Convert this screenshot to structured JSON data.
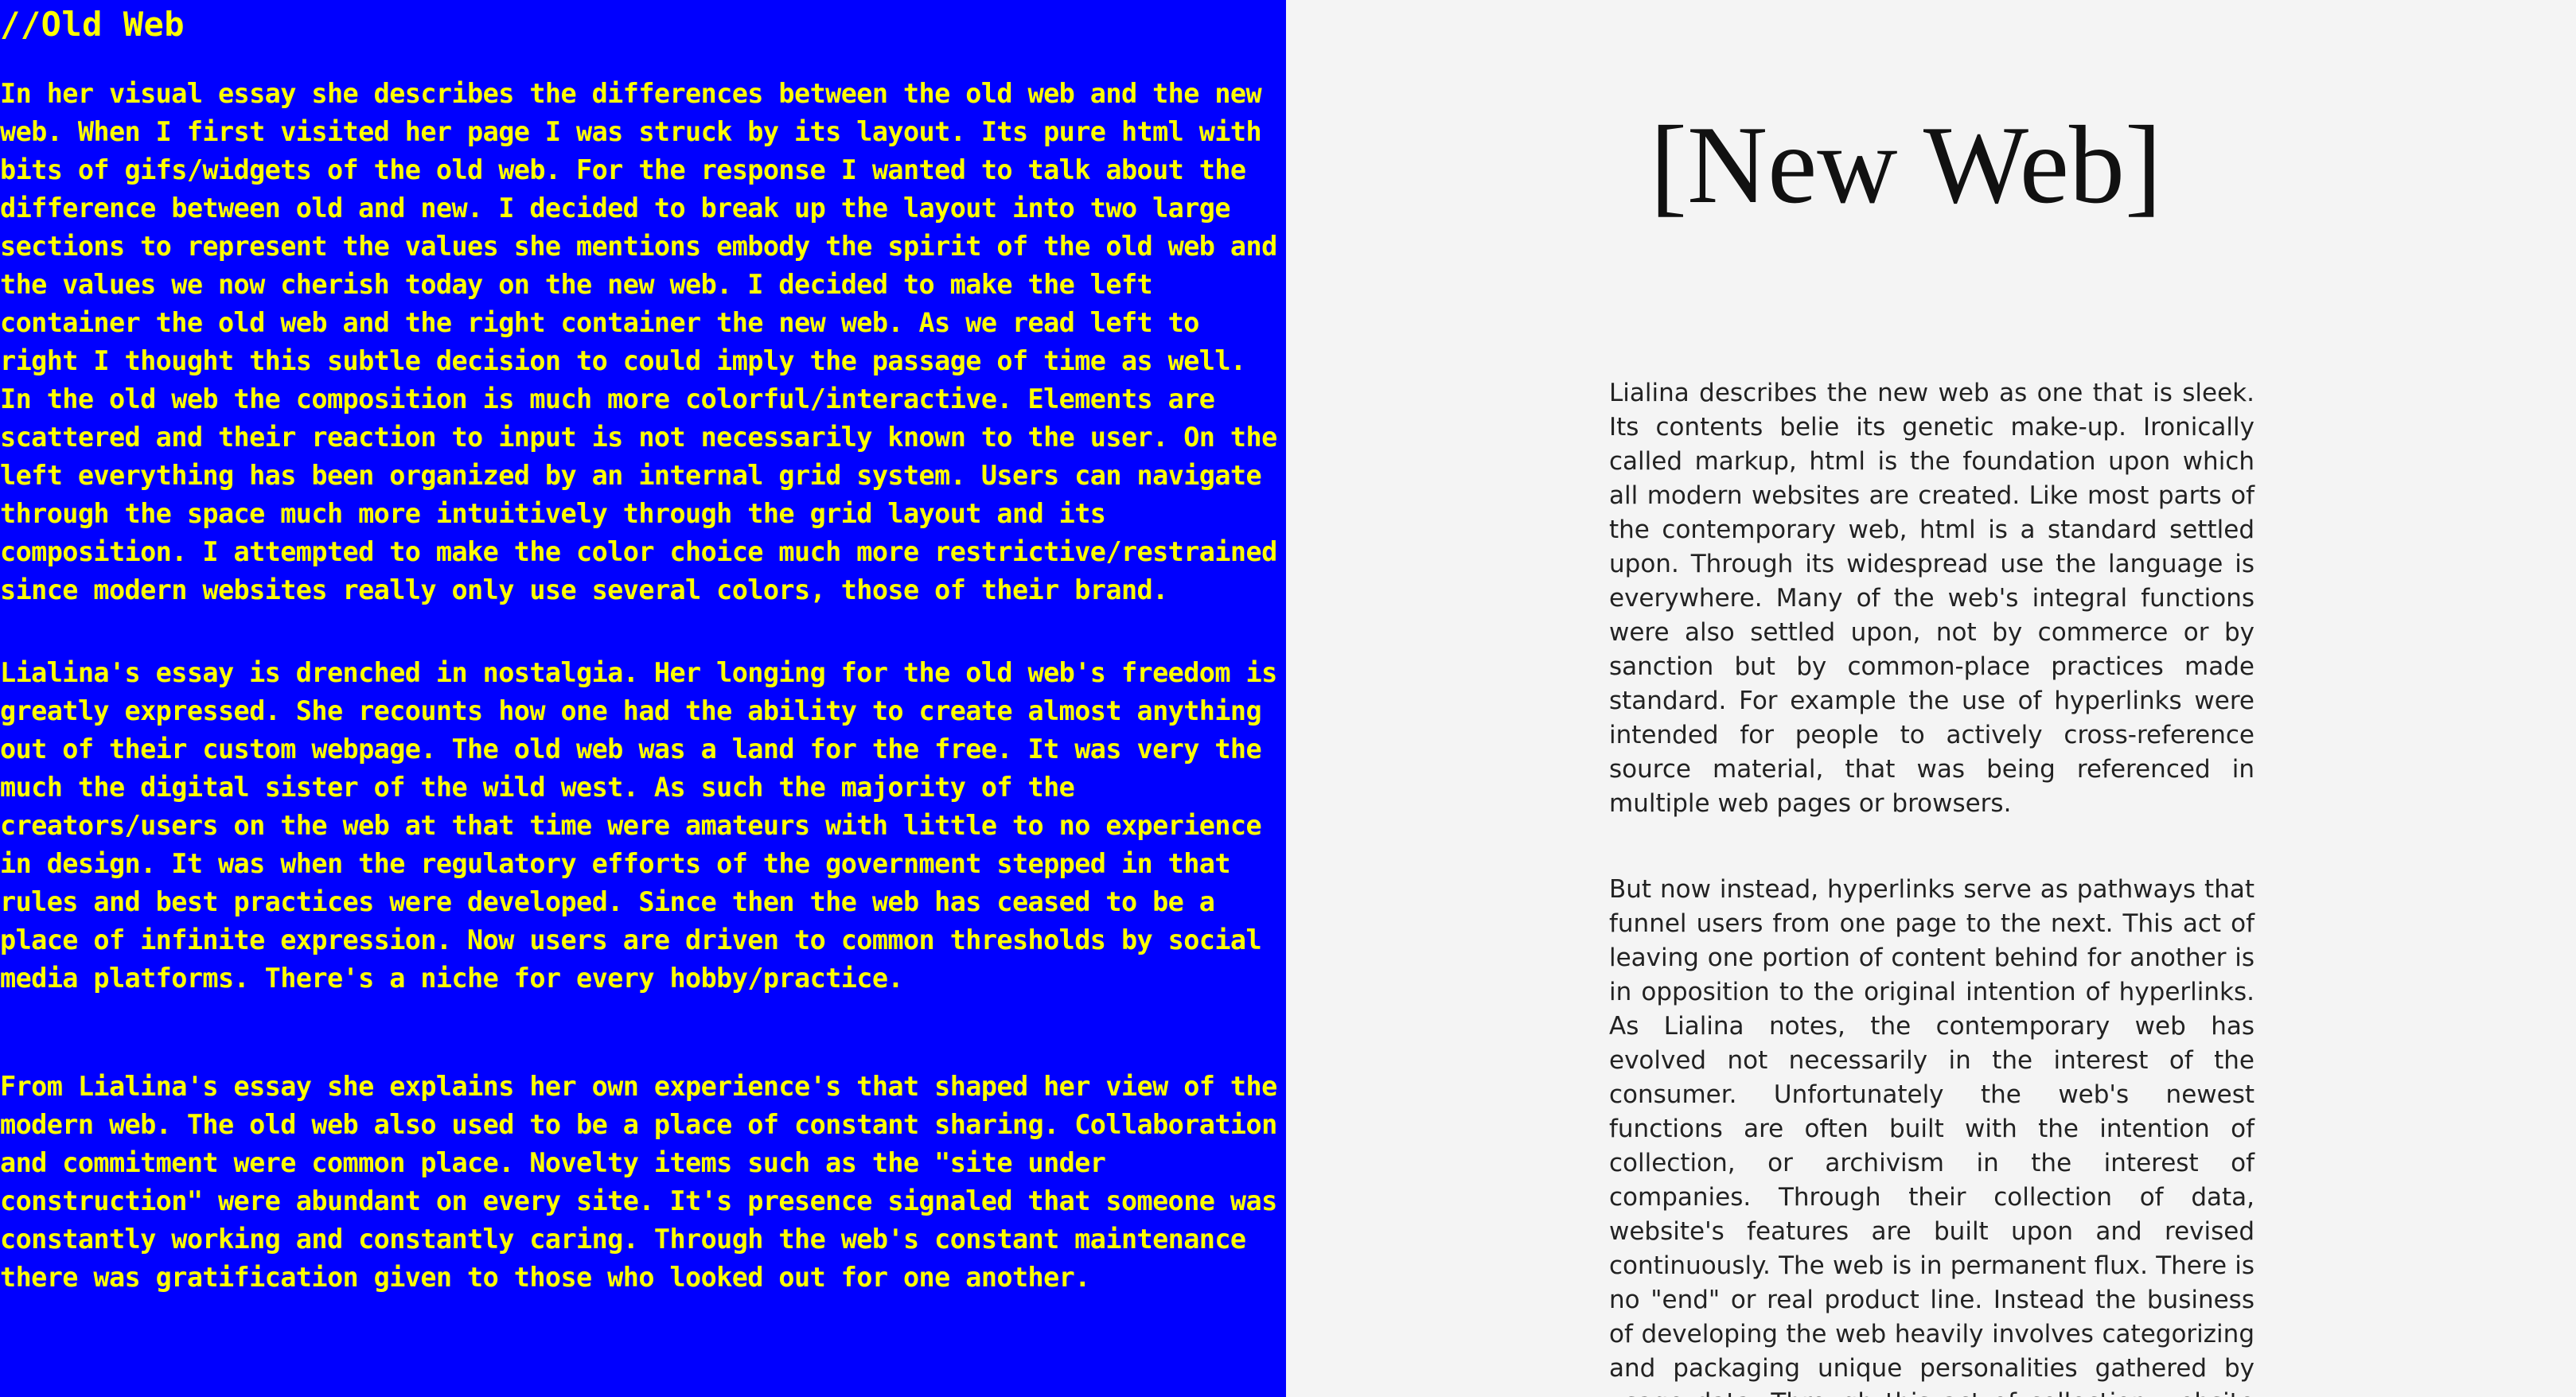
{
  "old_web": {
    "title": "//Old Web",
    "paragraphs": [
      "In her visual essay she describes the differences between the old web and the new web. When I first visited her page I was struck by its layout. Its pure html with bits of gifs/widgets of the old web. For the response I wanted to talk about the difference between old and new. I decided to break up the layout into two large sections to represent the values she mentions embody the spirit of the old web and the values we now cherish today on the new web. I decided to make the left container the old web and the right container the new web. As we read left to right I thought this subtle decision to could imply the passage of time as well. In the old web the composition is much more colorful/interactive. Elements are scattered and their reaction to input is not necessarily known to the user. On the left everything has been organized by an internal grid system. Users can navigate through the space much more intuitively through the grid layout and its composition. I attempted to make the color choice much more restrictive/restrained since modern websites really only use several colors, those of their brand.",
      "Lialina's essay is drenched in nostalgia. Her longing for the old web's freedom is greatly expressed. She recounts how one had the ability to create almost anything out of their custom webpage. The old web was a land for the free. It was very the much the digital sister of the wild west. As such the majority of the creators/users on the web at that time were amateurs with little to no experience in design. It was when the regulatory efforts of the government stepped in that rules and best practices were developed. Since then the web has ceased to be a place of infinite expression. Now users are driven to common thresholds by social media platforms. There's a niche for every hobby/practice.",
      "From Lialina's essay she explains her own experience's that shaped her view of the modern web. The old web also used to be a place of constant sharing. Collaboration and commitment were common place. Novelty items such as the \"site under construction\" were abundant on every site. It's presence signaled that someone was constantly working and constantly caring. Through the web's constant maintenance there was gratification given to those who looked out for one another."
    ]
  },
  "new_web": {
    "title": "[New Web]",
    "paragraphs": [
      "Lialina describes the new web as one that is sleek. Its contents belie its genetic make-up. Ironically called markup, html is the foundation upon which all modern websites are created. Like most parts of the contemporary web, html is a standard settled upon. Through its widespread use the language is everywhere. Many of the web's integral functions were also settled upon, not by commerce or by sanction but by common-place practices made standard. For example the use of hyperlinks were intended for people to actively cross-reference source material, that was being referenced in multiple web pages or browsers.",
      "But now instead, hyperlinks serve as pathways that funnel users from one page to the next. This act of leaving one portion of content behind for another is in opposition to the original intention of hyperlinks. As Lialina notes, the contemporary web has evolved not necessarily in the interest of the consumer. Unfortunately the web's newest functions are often built with the intention of collection, or archivism in the interest of companies. Through their collection of data, website's features are built upon and revised continuously. The web is in permanent flux. There is no \"end\" or real product line. Instead the business of developing the web heavily involves categorizing and packaging unique personalities gathered by usage data. Through this act of collection website managers"
    ]
  },
  "colors": {
    "old_web_background": "#0000ff",
    "old_web_text": "#ffff00",
    "new_web_background": "#f4f4f4",
    "new_web_text": "#222222"
  }
}
